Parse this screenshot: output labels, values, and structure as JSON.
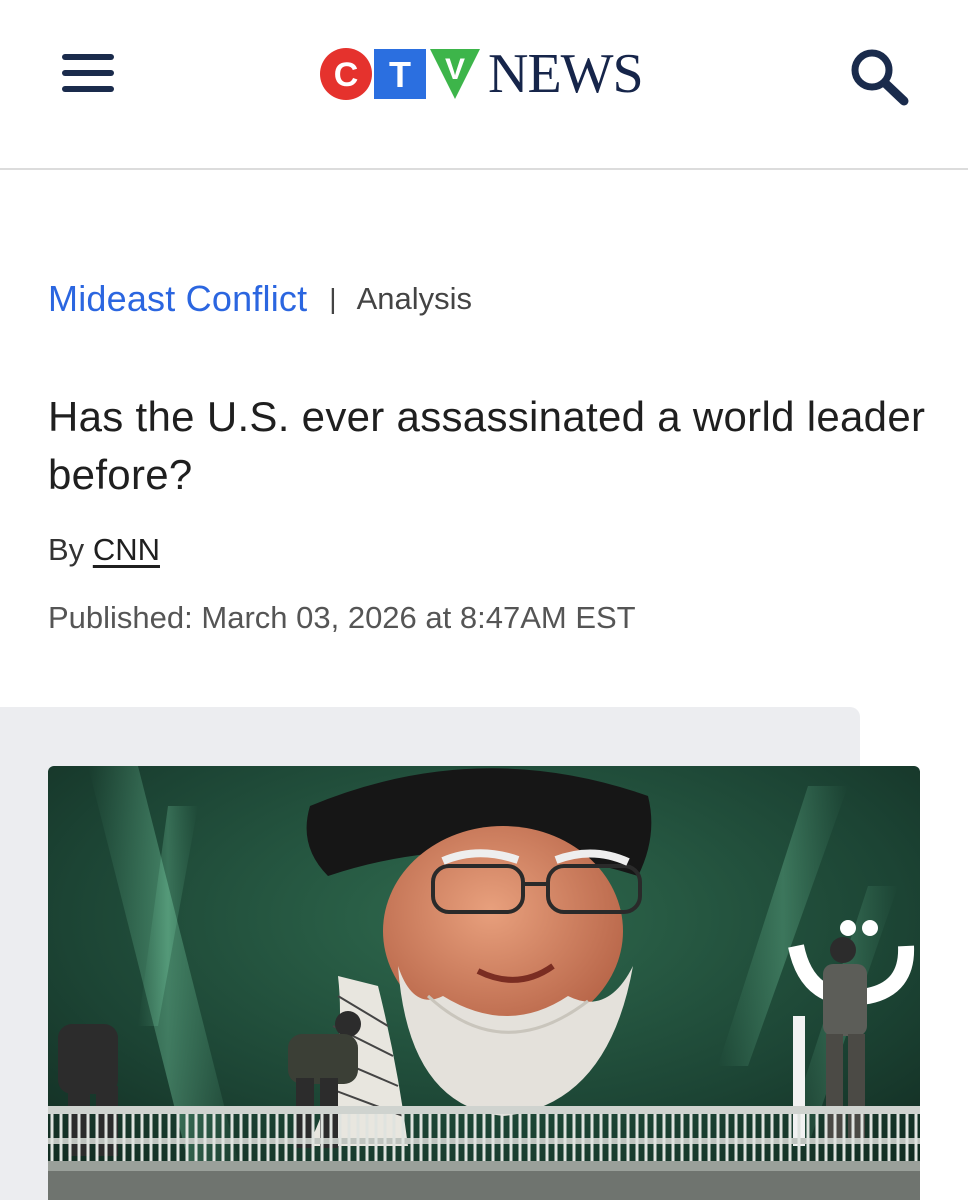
{
  "header": {
    "menu_icon": "hamburger-menu-icon",
    "logo": {
      "letters": [
        "C",
        "T",
        "V"
      ],
      "wordmark": "NEWS",
      "colors": [
        "#e5322d",
        "#2b6fe0",
        "#3db54a"
      ]
    },
    "search_icon": "search-icon",
    "brand_color": "#16254a"
  },
  "article": {
    "section": "Mideast Conflict",
    "separator": "|",
    "type": "Analysis",
    "headline": "Has the U.S. ever assassinated a world leader before?",
    "byline_prefix": "By",
    "author": "CNN",
    "published": "Published: March 03, 2026 at 8:47AM EST"
  },
  "image": {
    "description": "Workers installing a large billboard of a bearded cleric in glasses and a black turban above a railing"
  },
  "colors": {
    "section_link": "#2b66e0",
    "media_background": "#ecedf0"
  }
}
